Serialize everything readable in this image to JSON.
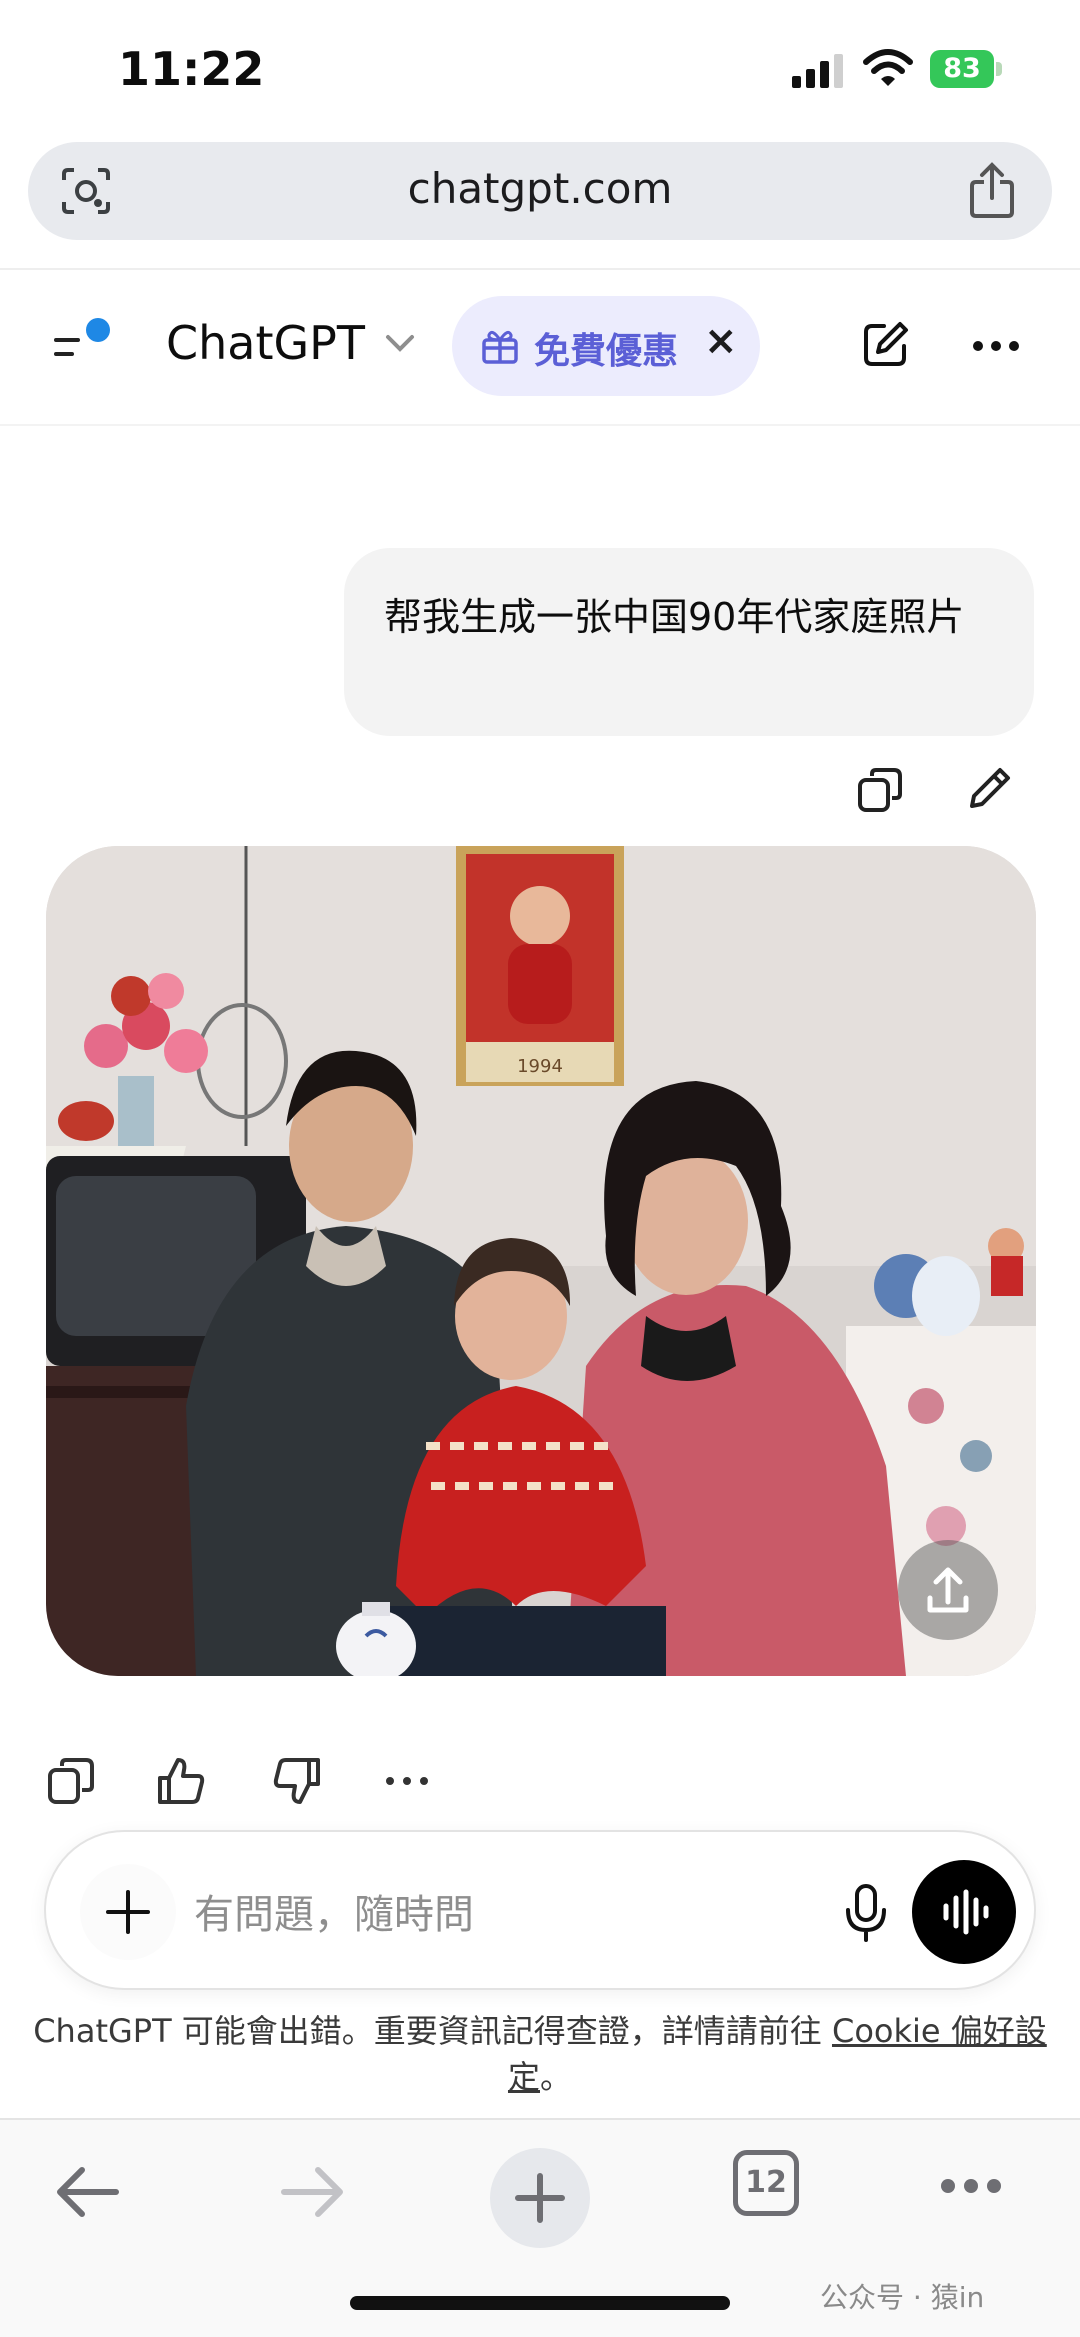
{
  "status_bar": {
    "time": "11:22",
    "battery": "83"
  },
  "browser": {
    "url": "chatgpt.com",
    "tab_count": "12"
  },
  "header": {
    "title": "ChatGPT",
    "promo_label": "免費優惠",
    "promo_close": "×"
  },
  "chat": {
    "user_message": "帮我生成一张中国90年代家庭照片",
    "calendar_year": "1994"
  },
  "composer": {
    "placeholder": "有問題，隨時問"
  },
  "disclaimer": {
    "text": "ChatGPT 可能會出錯。重要資訊記得查證，詳情請前往 ",
    "link": "Cookie 偏好設定",
    "end": "。"
  },
  "watermark": "公众号 · 猿in",
  "colors": {
    "accent": "#5b5fd6",
    "promo_bg": "#ececfd",
    "battery": "#34c759",
    "dot": "#1e88e5"
  },
  "icons": [
    "camera-lens-icon",
    "share-icon",
    "sidebar-menu-icon",
    "chevron-down-icon",
    "gift-icon",
    "close-icon",
    "edit-icon",
    "more-icon",
    "copy-icon",
    "pencil-icon",
    "upload-icon",
    "thumbs-up-icon",
    "thumbs-down-icon",
    "plus-icon",
    "mic-icon",
    "voice-icon",
    "back-arrow-icon",
    "forward-arrow-icon",
    "tabs-icon"
  ]
}
